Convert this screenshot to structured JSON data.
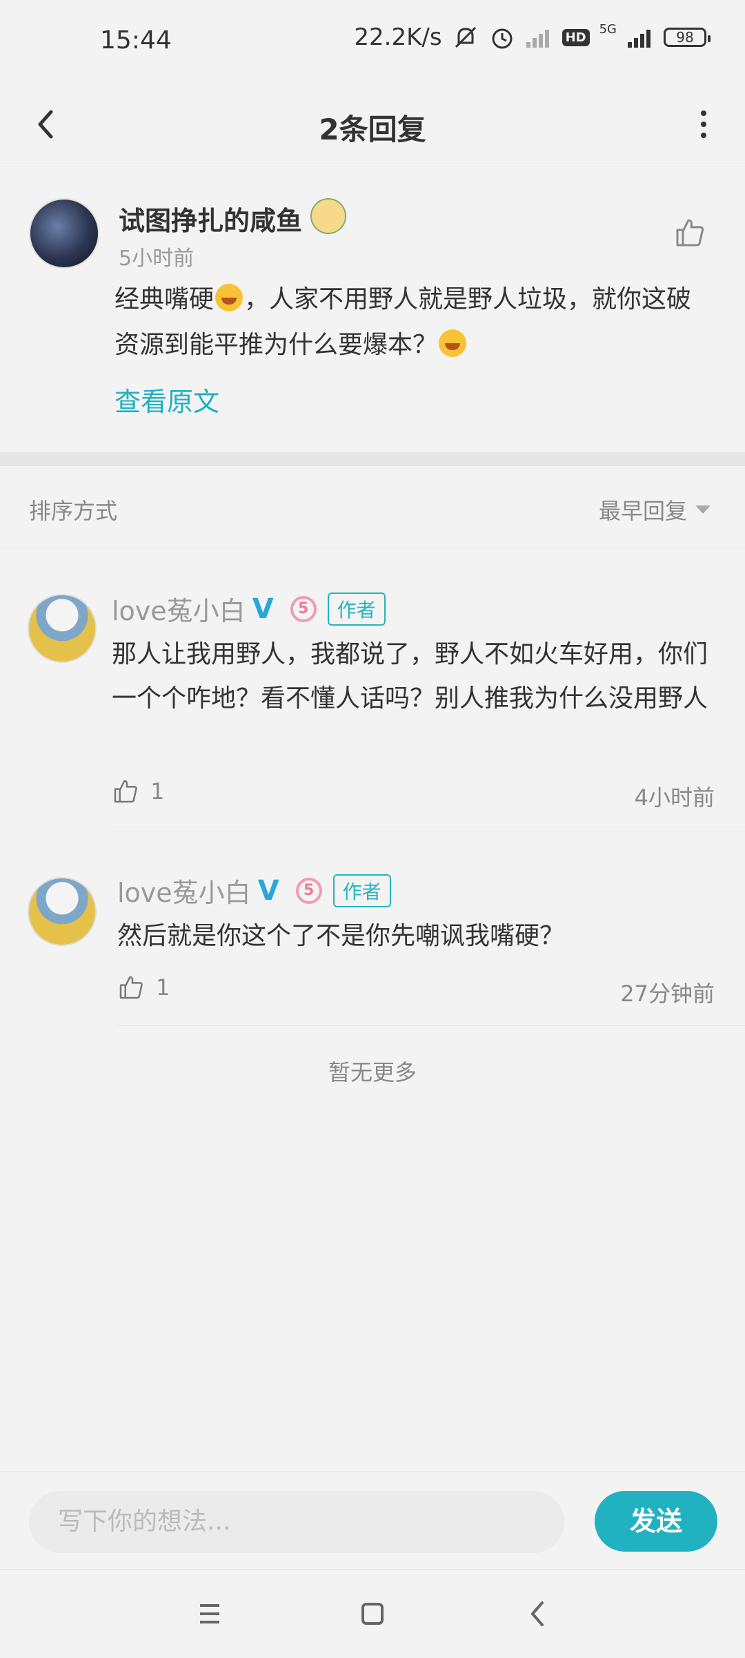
{
  "status_bar": {
    "time": "15:44",
    "net_speed": "22.2K/s",
    "hd_label": "HD",
    "network_label": "5G",
    "battery": "98"
  },
  "nav": {
    "title": "2条回复"
  },
  "main_comment": {
    "username": "试图挣扎的咸鱼",
    "time": "5小时前",
    "text_part1": "经典嘴硬",
    "text_part2": "，人家不用野人就是野人垃圾，就你这破资源到能平推为什么要爆本？",
    "view_original": "查看原文"
  },
  "sort": {
    "label": "排序方式",
    "value": "最早回复"
  },
  "replies": [
    {
      "username": "love菟小白",
      "verified": "V",
      "level": "5",
      "tag": "作者",
      "text": "那人让我用野人，我都说了，野人不如火车好用，你们一个个咋地？看不懂人话吗？别人推我为什么没用野人",
      "likes": "1",
      "time": "4小时前"
    },
    {
      "username": "love菟小白",
      "verified": "V",
      "level": "5",
      "tag": "作者",
      "text": "然后就是你这个了不是你先嘲讽我嘴硬？",
      "likes": "1",
      "time": "27分钟前"
    }
  ],
  "footer": {
    "no_more": "暂无更多"
  },
  "input": {
    "placeholder": "写下你的想法...",
    "send_label": "发送"
  },
  "colors": {
    "accent": "#20b2c0",
    "verified": "#27a8d8",
    "level": "#f07995"
  }
}
